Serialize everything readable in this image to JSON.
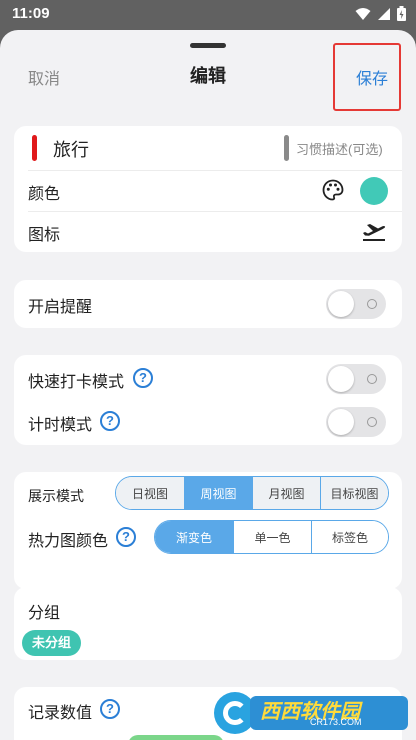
{
  "status": {
    "time": "11:09"
  },
  "header": {
    "cancel": "取消",
    "title": "编辑",
    "save": "保存"
  },
  "habit": {
    "name": "旅行",
    "description_placeholder": "习惯描述(可选)",
    "color_label": "颜色",
    "color_value": "#41c9b7",
    "name_marker_color": "#e0191b",
    "icon_label": "图标",
    "icon_name": "airplane-takeoff-icon"
  },
  "reminder": {
    "label": "开启提醒",
    "enabled": false
  },
  "modes": {
    "quick_checkin_label": "快速打卡模式",
    "quick_checkin_enabled": false,
    "timer_label": "计时模式",
    "timer_enabled": false,
    "help_glyph": "?"
  },
  "display": {
    "mode_label": "展示模式",
    "mode_options": [
      "日视图",
      "周视图",
      "月视图",
      "目标视图"
    ],
    "mode_selected": "周视图",
    "heatmap_label": "热力图颜色",
    "heatmap_options": [
      "渐变色",
      "单一色",
      "标签色"
    ],
    "heatmap_selected": "渐变色"
  },
  "group": {
    "label": "分组",
    "chip": "未分组"
  },
  "record": {
    "label": "记录数值"
  },
  "watermark": {
    "main": "西西软件园",
    "sub": "CR173.COM"
  }
}
